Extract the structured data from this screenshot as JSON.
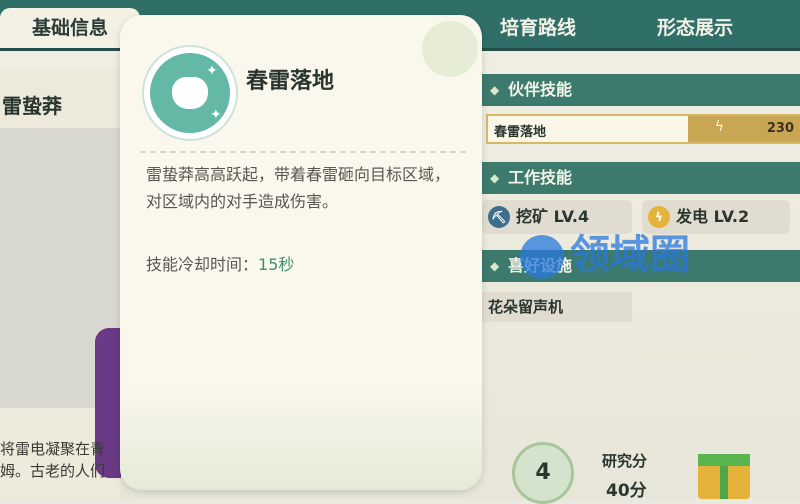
{
  "tabs": {
    "basic": "基础信息",
    "route": "培育路线",
    "form": "形态展示"
  },
  "pet": {
    "name": "雷蛰莽",
    "desc_lines": [
      "将雷电凝聚在青",
      "姆。古老的人们"
    ]
  },
  "popup": {
    "title": "春雷落地",
    "description": "雷蛰莽高高跃起，带着春雷砸向目标区域，对区域内的对手造成伤害。",
    "cooldown_label": "技能冷却时间：",
    "cooldown_value": "15秒"
  },
  "partner_skill": {
    "header": "伙伴技能",
    "name": "春雷落地",
    "value": "230"
  },
  "work_skills": {
    "header": "工作技能",
    "items": [
      {
        "label": "挖矿 LV.4",
        "icon": "pickaxe-icon"
      },
      {
        "label": "发电 LV.2",
        "icon": "lightning-icon"
      }
    ]
  },
  "favorite_facility": {
    "header": "喜好设施",
    "item": "花朵留声机"
  },
  "research": {
    "level": "4",
    "label": "研究分",
    "score": "40分"
  },
  "watermark": "领域圈",
  "colors": {
    "tab_bar": "#2f6f68",
    "section_header": "#3c7a6e",
    "skill_bar": "#c8a653",
    "accent_text": "#3e8f6e"
  }
}
